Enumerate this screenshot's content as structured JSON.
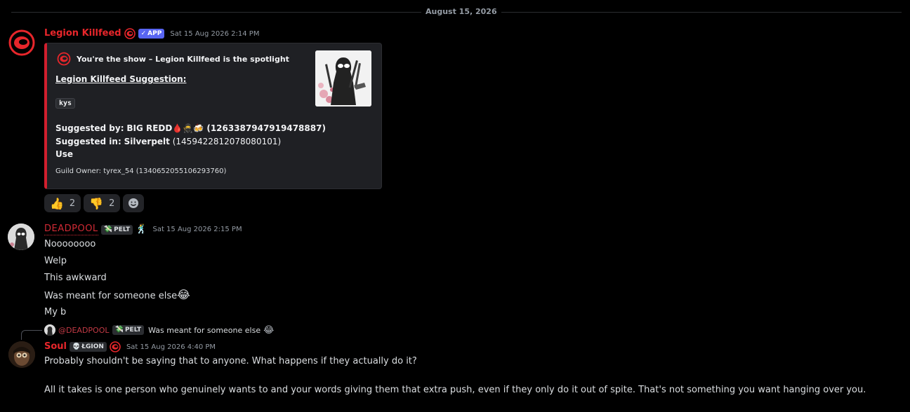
{
  "date_divider": "August 15, 2026",
  "messages": [
    {
      "author": "Legion Killfeed",
      "author_color": "#e8262b",
      "badge": "APP",
      "timestamp": "Sat 15 Aug 2026 2:14 PM",
      "embed": {
        "accent": "#d21f2e",
        "author_line": "You're the show – Legion Killfeed is the spotlight",
        "title": "Legion Killfeed Suggestion:",
        "code": "kys",
        "suggested_by_label": "Suggested by:",
        "suggested_by_value": "BIG REDD🩸🥷🍻 (1263387947919478887)",
        "suggested_in_label": "Suggested in:",
        "suggested_in_server": "Silverpelt",
        "suggested_in_id": "(1459422812078080101)",
        "use_label": "Use",
        "footer": "Guild Owner: tyrex_54 (1340652055106293760)"
      },
      "reactions": [
        {
          "emoji": "👍",
          "count": "2"
        },
        {
          "emoji": "👎",
          "count": "2"
        }
      ],
      "add_reaction_icon": "add-reaction-icon"
    },
    {
      "author": "DEADPOOL",
      "author_color": "#d12a35",
      "tag": "PELT",
      "tag_icon": "💸",
      "extra_icon": "🕺",
      "timestamp": "Sat 15 Aug 2026 2:15 PM",
      "lines": [
        "Noooooooo",
        "Welp",
        "This awkward",
        "Was meant for someone else",
        "My b"
      ],
      "line4_emoji": "😂"
    },
    {
      "reply_to": {
        "author": "@DEADPOOL",
        "tag": "PELT",
        "tag_icon": "💸",
        "preview": "Was meant for someone else",
        "preview_emoji": "😂"
      },
      "author": "Soul",
      "author_color": "#e8262b",
      "tag": "ŁGION",
      "tag_icon": "💀",
      "timestamp": "Sat 15 Aug 2026 4:40 PM",
      "lines": [
        "Probably shouldn't be saying that to anyone. What happens if they actually do it?",
        "All it takes is one person who genuinely wants to and your words giving them that extra push, even if they only do it out of spite. That's not something you want hanging over you."
      ]
    }
  ]
}
